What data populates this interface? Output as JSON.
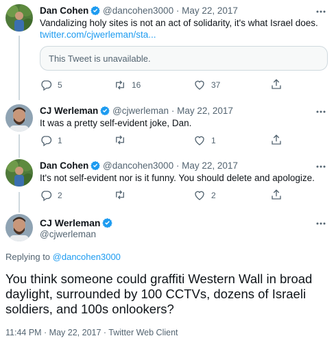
{
  "tweets": [
    {
      "name": "Dan Cohen",
      "handle": "@dancohen3000",
      "separator": "·",
      "date": "May 22, 2017",
      "text": "Vandalizing holy sites is not an act of solidarity, it's what Israel does.",
      "link": "twitter.com/cjwerleman/sta...",
      "quoted": "This Tweet is unavailable.",
      "replies": "5",
      "retweets": "16",
      "likes": "37"
    },
    {
      "name": "CJ Werleman",
      "handle": "@cjwerleman",
      "separator": "·",
      "date": "May 22, 2017",
      "text": "It was a pretty self-evident joke, Dan.",
      "replies": "1",
      "retweets": "",
      "likes": "1"
    },
    {
      "name": "Dan Cohen",
      "handle": "@dancohen3000",
      "separator": "·",
      "date": "May 22, 2017",
      "text": "It's not self-evident nor is it funny. You should delete and apologize.",
      "replies": "2",
      "retweets": "",
      "likes": "2"
    }
  ],
  "main": {
    "name": "CJ Werleman",
    "handle": "@cjwerleman",
    "replying_prefix": "Replying to",
    "replying_handle": "@dancohen3000",
    "text": "You think someone could graffiti Western Wall in broad daylight, surrounded by 100 CCTVs, dozens of Israeli soldiers, and 100s onlookers?",
    "meta": "11:44 PM · May 22, 2017 · Twitter Web Client"
  },
  "colors": {
    "accent": "#1d9bf0",
    "muted": "#536471",
    "text": "#0f1419",
    "border": "#cfd9de"
  },
  "icons": [
    "verified-badge-icon",
    "more-icon",
    "reply-icon",
    "retweet-icon",
    "like-icon",
    "share-icon"
  ]
}
